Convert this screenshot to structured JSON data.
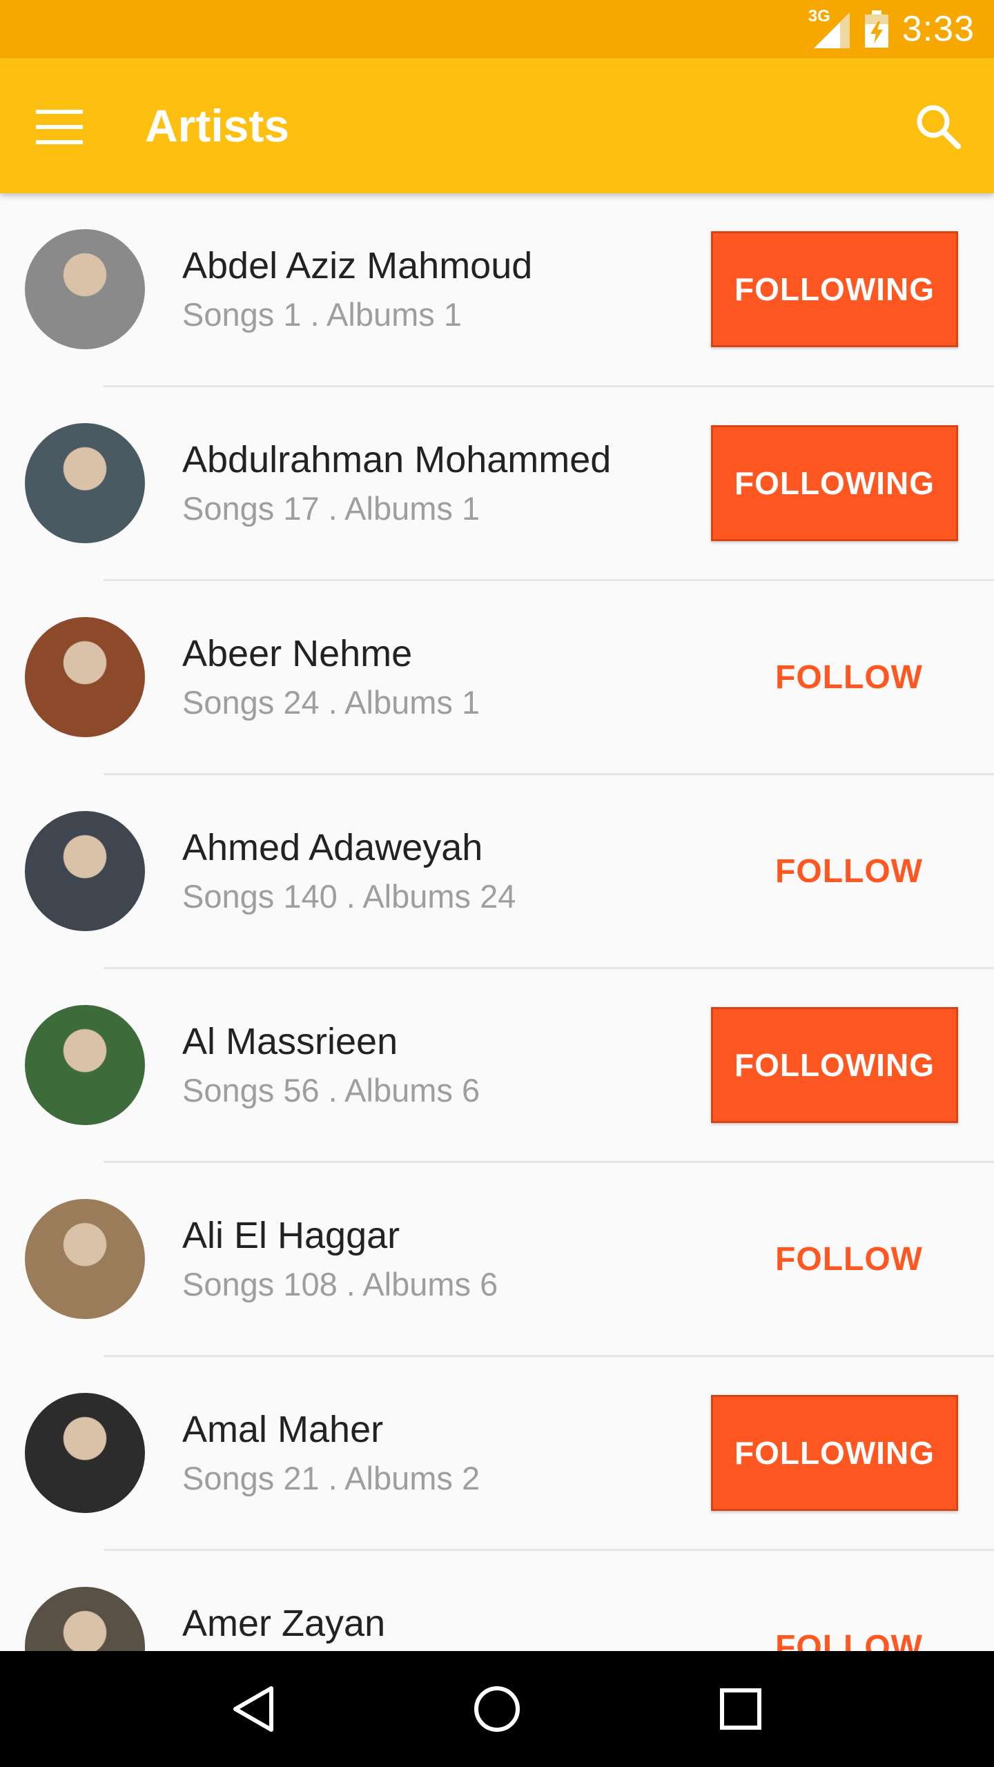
{
  "status_bar": {
    "network": "3G",
    "time": "3:33",
    "icons": [
      "signal-icon",
      "battery-charging-icon"
    ]
  },
  "app_bar": {
    "title": "Artists",
    "icons": [
      "menu-icon",
      "search-icon"
    ]
  },
  "artists": [
    {
      "name": "Abdel Aziz Mahmoud",
      "stats": "Songs 1 . Albums 1",
      "button": "FOLLOWING",
      "following": true,
      "avatar_color": "#8a8a8a"
    },
    {
      "name": "Abdulrahman Mohammed",
      "stats": "Songs 17 . Albums 1",
      "button": "FOLLOWING",
      "following": true,
      "avatar_color": "#4a5a63"
    },
    {
      "name": "Abeer Nehme",
      "stats": "Songs 24 . Albums 1",
      "button": "FOLLOW",
      "following": false,
      "avatar_color": "#8d4a2a"
    },
    {
      "name": "Ahmed Adaweyah",
      "stats": "Songs 140 . Albums 24",
      "button": "FOLLOW",
      "following": false,
      "avatar_color": "#3f4650"
    },
    {
      "name": "Al Massrieen",
      "stats": "Songs 56 . Albums 6",
      "button": "FOLLOWING",
      "following": true,
      "avatar_color": "#3d6b3a"
    },
    {
      "name": "Ali El Haggar",
      "stats": "Songs 108 . Albums 6",
      "button": "FOLLOW",
      "following": false,
      "avatar_color": "#9a7b5a"
    },
    {
      "name": "Amal Maher",
      "stats": "Songs 21 . Albums 2",
      "button": "FOLLOWING",
      "following": true,
      "avatar_color": "#2c2c2c"
    },
    {
      "name": "Amer Zayan",
      "stats": "",
      "button": "FOLLOW",
      "following": false,
      "avatar_color": "#5a5146"
    }
  ],
  "nav_bar": {
    "icons": [
      "back-icon",
      "home-icon",
      "recents-icon"
    ]
  },
  "colors": {
    "status_bar": "#f6a800",
    "app_bar": "#fec010",
    "accent": "#ff5722"
  }
}
